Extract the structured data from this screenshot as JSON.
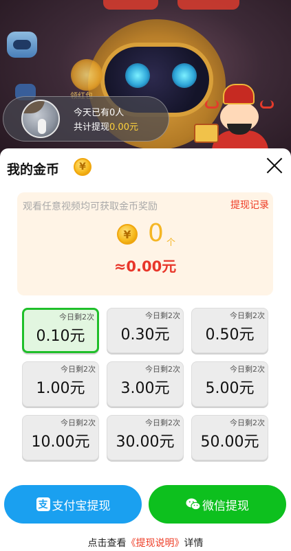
{
  "background": {
    "red_envelope_label": "领红包"
  },
  "notice": {
    "line1": "今天已有0人",
    "line2_prefix": "共计提现",
    "line2_amount": "0.00元"
  },
  "sheet": {
    "title": "我的金币",
    "title_coin_glyph": "¥",
    "close_icon": "close-icon"
  },
  "balance": {
    "hint": "观看任意视频均可获取金币奖励",
    "record_link": "提现记录",
    "coin_glyph": "¥",
    "coin_count": "0",
    "coin_unit": "个",
    "money": "≈0.00元"
  },
  "options": [
    {
      "badge": "今日剩2次",
      "amount": "0.10元",
      "selected": true
    },
    {
      "badge": "今日剩2次",
      "amount": "0.30元",
      "selected": false
    },
    {
      "badge": "今日剩2次",
      "amount": "0.50元",
      "selected": false
    },
    {
      "badge": "今日剩2次",
      "amount": "1.00元",
      "selected": false
    },
    {
      "badge": "今日剩2次",
      "amount": "3.00元",
      "selected": false
    },
    {
      "badge": "今日剩2次",
      "amount": "5.00元",
      "selected": false
    },
    {
      "badge": "今日剩2次",
      "amount": "10.00元",
      "selected": false
    },
    {
      "badge": "今日剩2次",
      "amount": "30.00元",
      "selected": false
    },
    {
      "badge": "今日剩2次",
      "amount": "50.00元",
      "selected": false
    }
  ],
  "buttons": {
    "alipay_icon_glyph": "支",
    "alipay_label": "支付宝提现",
    "wechat_label": "微信提现"
  },
  "footer": {
    "prefix": "点击查看",
    "link": "《提现说明》",
    "suffix": "详情"
  },
  "colors": {
    "accent_red": "#ee3b24",
    "alipay_blue": "#1aa0f0",
    "wechat_green": "#0dc01e",
    "coin_gold": "#f5b624",
    "selected_border": "#1fbf2a"
  }
}
